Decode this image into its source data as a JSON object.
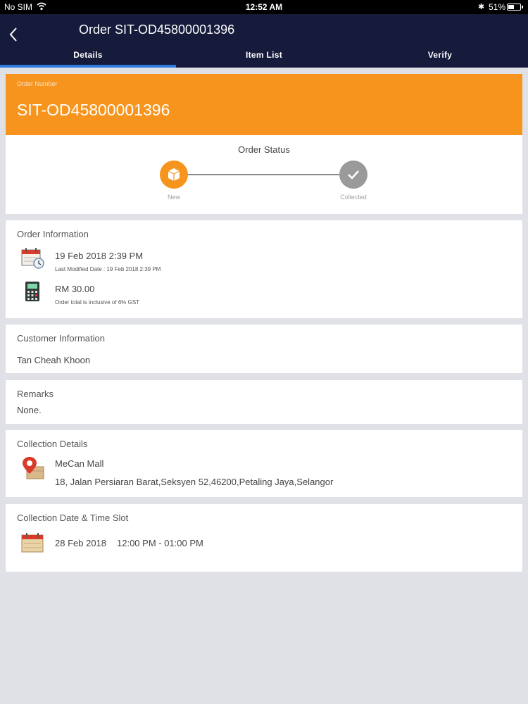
{
  "status_bar": {
    "carrier": "No SIM",
    "time": "12:52 AM",
    "battery": "51%",
    "battery_level": 0.51
  },
  "nav": {
    "back_icon": "chevron-left-icon",
    "title": "Order SIT-OD45800001396"
  },
  "tabs": [
    {
      "label": "Details",
      "active": true
    },
    {
      "label": "Item List",
      "active": false
    },
    {
      "label": "Verify",
      "active": false
    }
  ],
  "order_header": {
    "label": "Order Number",
    "number": "SIT-OD45800001396",
    "color": "#f7941d"
  },
  "order_status": {
    "heading": "Order Status",
    "steps": [
      {
        "label": "New",
        "icon": "box-icon",
        "state": "current"
      },
      {
        "label": "Collected",
        "icon": "check-icon",
        "state": "pending"
      }
    ]
  },
  "order_info": {
    "title": "Order Information",
    "date": "19 Feb 2018 2:39 PM",
    "last_modified": "Last Modified Date :  19 Feb 2018 2:39 PM",
    "amount": "RM 30.00",
    "amount_note": "Order total is inclusive of 6% GST"
  },
  "customer_info": {
    "title": "Customer Information",
    "name": "Tan Cheah Khoon"
  },
  "remarks": {
    "title": "Remarks",
    "value": "None."
  },
  "collection_details": {
    "title": "Collection Details",
    "location": "MeCan Mall",
    "address": "18, Jalan Persiaran Barat,Seksyen 52,46200,Petaling Jaya,Selangor"
  },
  "collection_slot": {
    "title": "Collection Date & Time Slot",
    "date": "28 Feb 2018",
    "time": "12:00 PM - 01:00 PM"
  }
}
